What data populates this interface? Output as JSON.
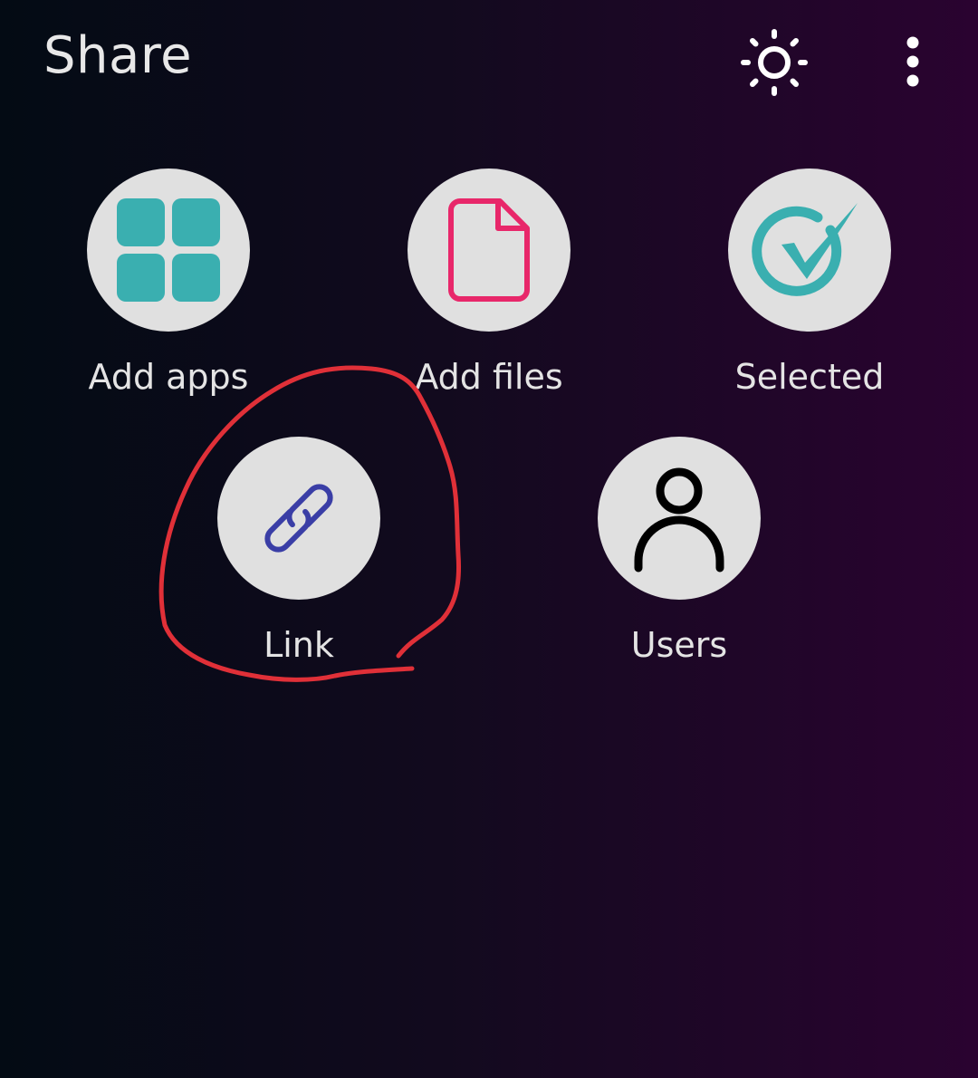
{
  "header": {
    "title": "Share",
    "brightness_icon": "brightness-icon",
    "more_icon": "more-vertical-icon"
  },
  "targets": [
    {
      "label": "Add apps",
      "icon": "apps-grid-icon",
      "color": "#3aafb0"
    },
    {
      "label": "Add files",
      "icon": "file-icon",
      "color": "#e8276a"
    },
    {
      "label": "Selected",
      "icon": "check-circle-icon",
      "color": "#3aafb0"
    },
    {
      "label": "Link",
      "icon": "link-icon",
      "color": "#3a3ea6"
    },
    {
      "label": "Users",
      "icon": "user-icon",
      "color": "#000000"
    }
  ],
  "annotation": {
    "color": "#e03038",
    "marks": "Link"
  },
  "colors": {
    "background_start": "#030b14",
    "background_end": "#2a0330",
    "circle": "#e0e0e0",
    "text": "#e4e4e4"
  }
}
